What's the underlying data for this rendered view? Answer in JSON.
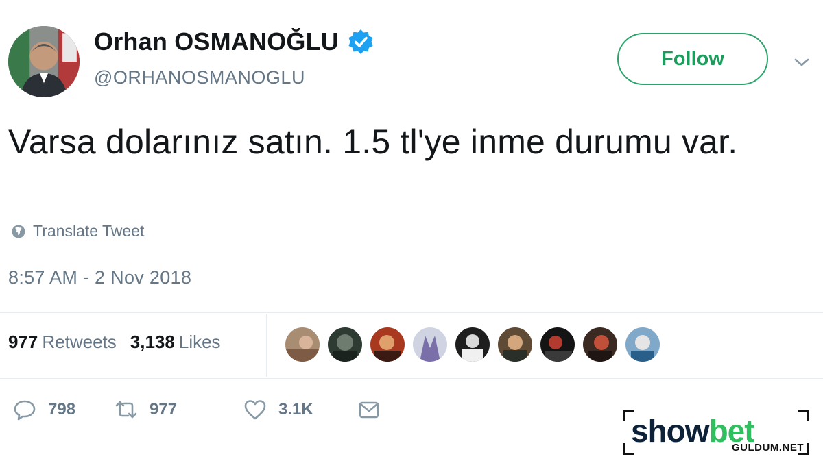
{
  "user": {
    "display_name": "Orhan OSMANOĞLU",
    "handle": "@ORHANOSMANOGLU",
    "verified": true,
    "verified_icon": "verified-badge-icon"
  },
  "header": {
    "follow_label": "Follow",
    "menu_icon": "chevron-down-icon"
  },
  "tweet": {
    "text": "Varsa dolarınız satın. 1.5 tl'ye inme durumu var.",
    "translate_label": "Translate Tweet",
    "translate_icon": "globe-icon",
    "timestamp": "8:57 AM - 2 Nov 2018"
  },
  "stats": {
    "retweets_count": "977",
    "retweets_label": "Retweets",
    "likes_count": "3,138",
    "likes_label": "Likes",
    "liker_avatar_count": 9
  },
  "actions": {
    "reply_count": "798",
    "retweet_count": "977",
    "like_count": "3.1K",
    "reply_icon": "reply-icon",
    "retweet_icon": "retweet-icon",
    "like_icon": "heart-icon",
    "message_icon": "envelope-icon"
  },
  "watermark": {
    "brand_part1": "show",
    "brand_part2": "bet",
    "site": "GULDUM.NET"
  },
  "colors": {
    "follow_green": "#2ba36a",
    "verified_blue": "#1da1f2",
    "muted_text": "#657786",
    "brand_navy": "#0d2238",
    "brand_green": "#2fbf5e"
  }
}
